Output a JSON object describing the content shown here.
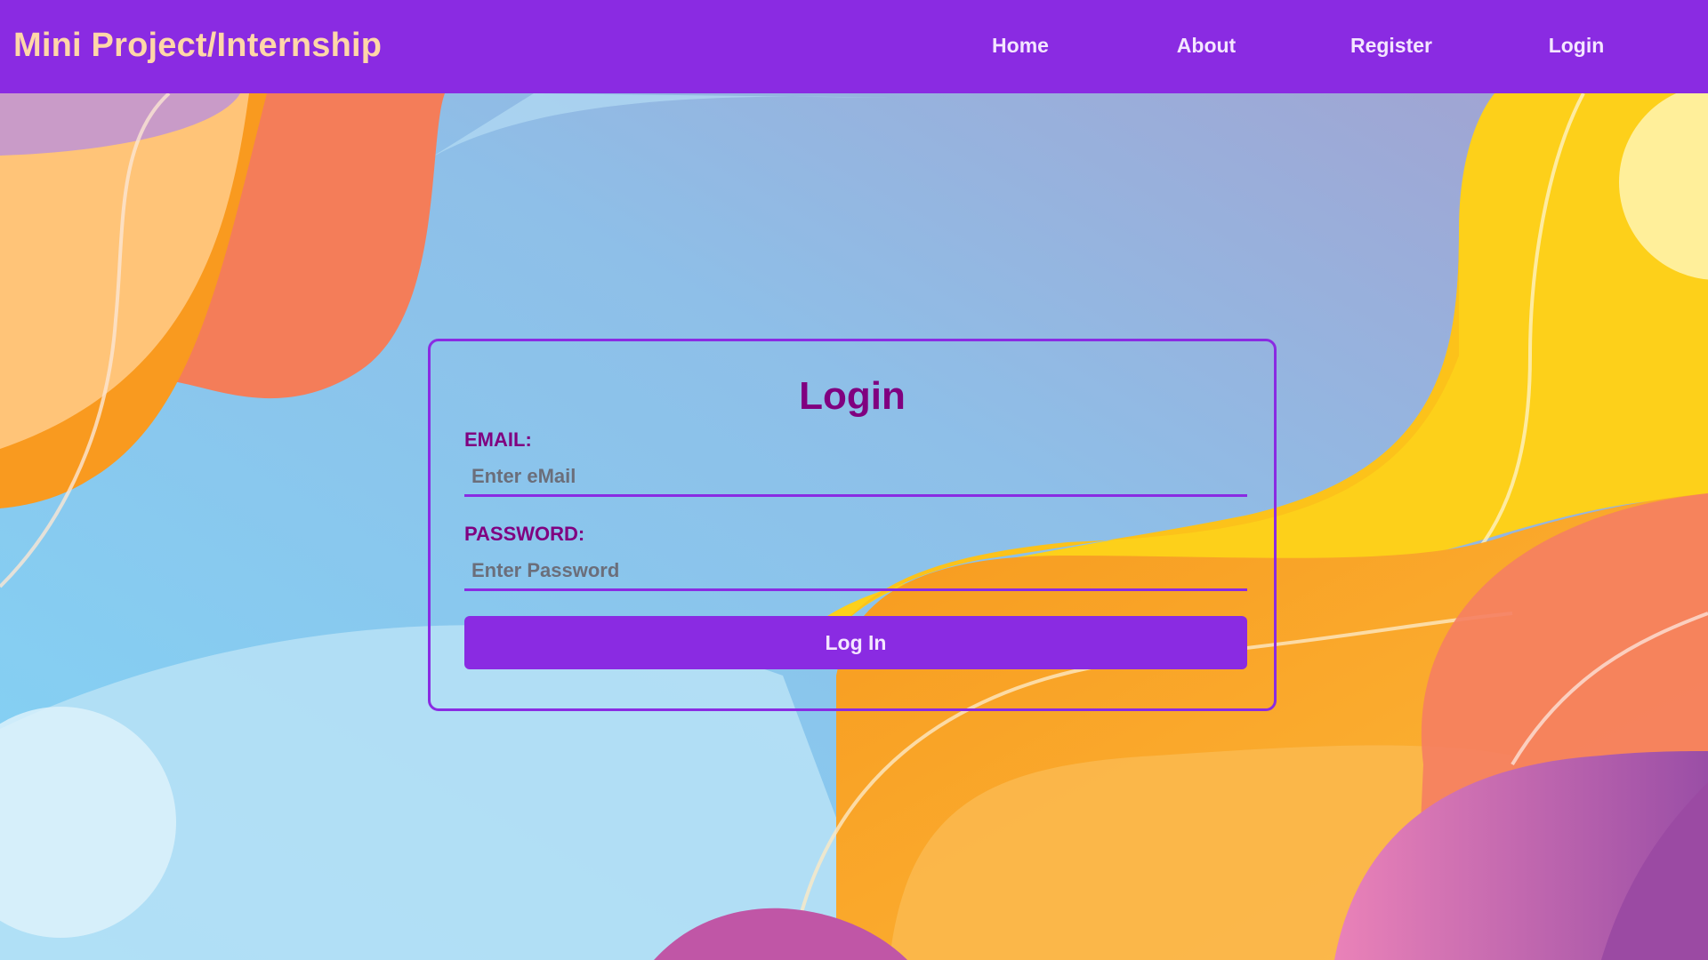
{
  "header": {
    "brand": "Mini Project/Internship",
    "nav": [
      {
        "label": "Home"
      },
      {
        "label": "About"
      },
      {
        "label": "Register"
      },
      {
        "label": "Login"
      }
    ]
  },
  "login_form": {
    "title": "Login",
    "email_label": "EMAIL:",
    "email_placeholder": "Enter eMail",
    "email_value": "",
    "password_label": "PASSWORD:",
    "password_placeholder": "Enter Password",
    "password_value": "",
    "submit_label": "Log In"
  },
  "colors": {
    "accent": "#8a2be2",
    "brand_text": "#ffd7a8",
    "form_text": "#800080",
    "background_sky": "#86cdf0",
    "background_orange": "#f7a022",
    "background_yellow": "#fcc41a",
    "background_pink": "#e47bb6"
  }
}
